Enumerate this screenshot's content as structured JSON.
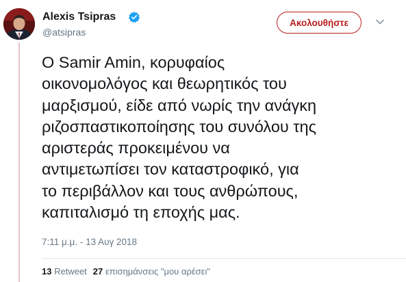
{
  "tweet": {
    "author": {
      "name": "Alexis Tsipras",
      "handle": "@atsipras",
      "verified": true,
      "avatar_icon": "profile-photo"
    },
    "follow_label": "Ακολουθήστε",
    "menu_icon": "chevron-down-icon",
    "text_lines": [
      "Ο Samir Amin, κορυφαίος",
      "οικονομολόγος και θεωρητικός του",
      "μαρξισμού, είδε από νωρίς την ανάγκη",
      "ριζοσπαστικοποίησης του συνόλου της",
      "αριστεράς προκειμένου να",
      "αντιμετωπίσει τον καταστροφικό, για",
      "το περιβάλλον και τους ανθρώπους,",
      "καπιταλισμό τη εποχής μας."
    ],
    "timestamp": "7:11 μ.μ. - 13 Αυγ 2018",
    "stats": {
      "retweets_count": "13",
      "retweets_label": "Retweet",
      "likes_count": "27",
      "likes_label": "επισημάνσεις \"μου αρέσει\""
    }
  },
  "colors": {
    "accent": "#b71c1c",
    "verified_badge": "#1da1f2",
    "secondary_text": "#657786",
    "thread_line": "#e6c3c3"
  }
}
